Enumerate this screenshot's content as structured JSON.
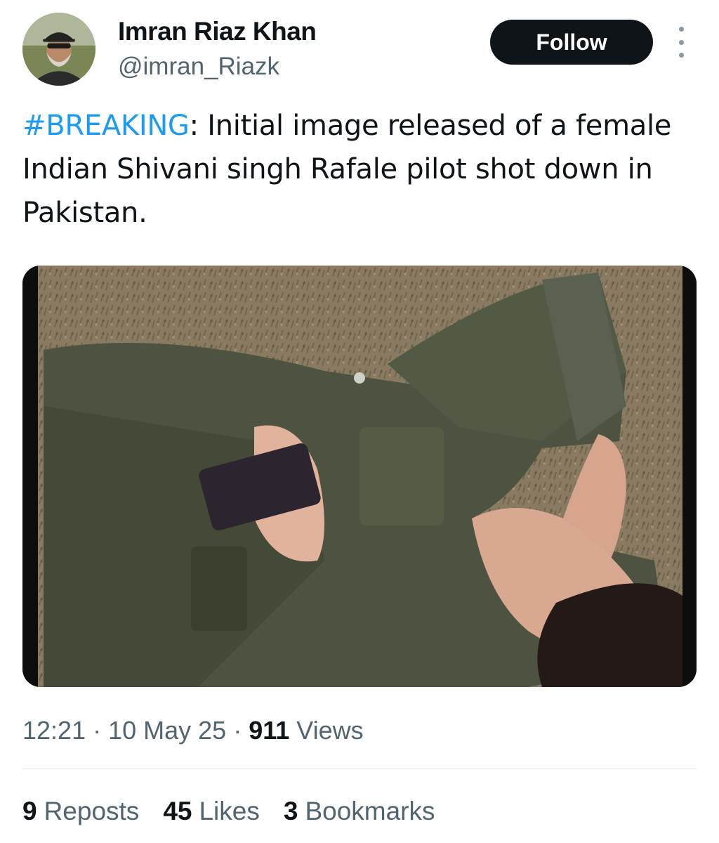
{
  "author": {
    "display_name": "Imran Riaz Khan",
    "handle": "@imran_Riazk",
    "avatar_icon": "profile-photo"
  },
  "actions": {
    "follow_label": "Follow",
    "more_icon": "more-vertical-icon"
  },
  "tweet": {
    "hashtag": "#BREAKING",
    "body": ": Initial image released of a female Indian Shivani singh Rafale pilot shot down in Pakistan."
  },
  "meta": {
    "time": "12:21",
    "separator1": " · ",
    "date": "10 May 25",
    "separator2": " · ",
    "views_count": "911",
    "views_label": "Views"
  },
  "stats": {
    "reposts_count": "9",
    "reposts_label": "Reposts",
    "likes_count": "45",
    "likes_label": "Likes",
    "bookmarks_count": "3",
    "bookmarks_label": "Bookmarks"
  },
  "colors": {
    "link": "#1d9bf0",
    "text": "#0f1419",
    "secondary": "#536471",
    "button_bg": "#0f1419"
  }
}
